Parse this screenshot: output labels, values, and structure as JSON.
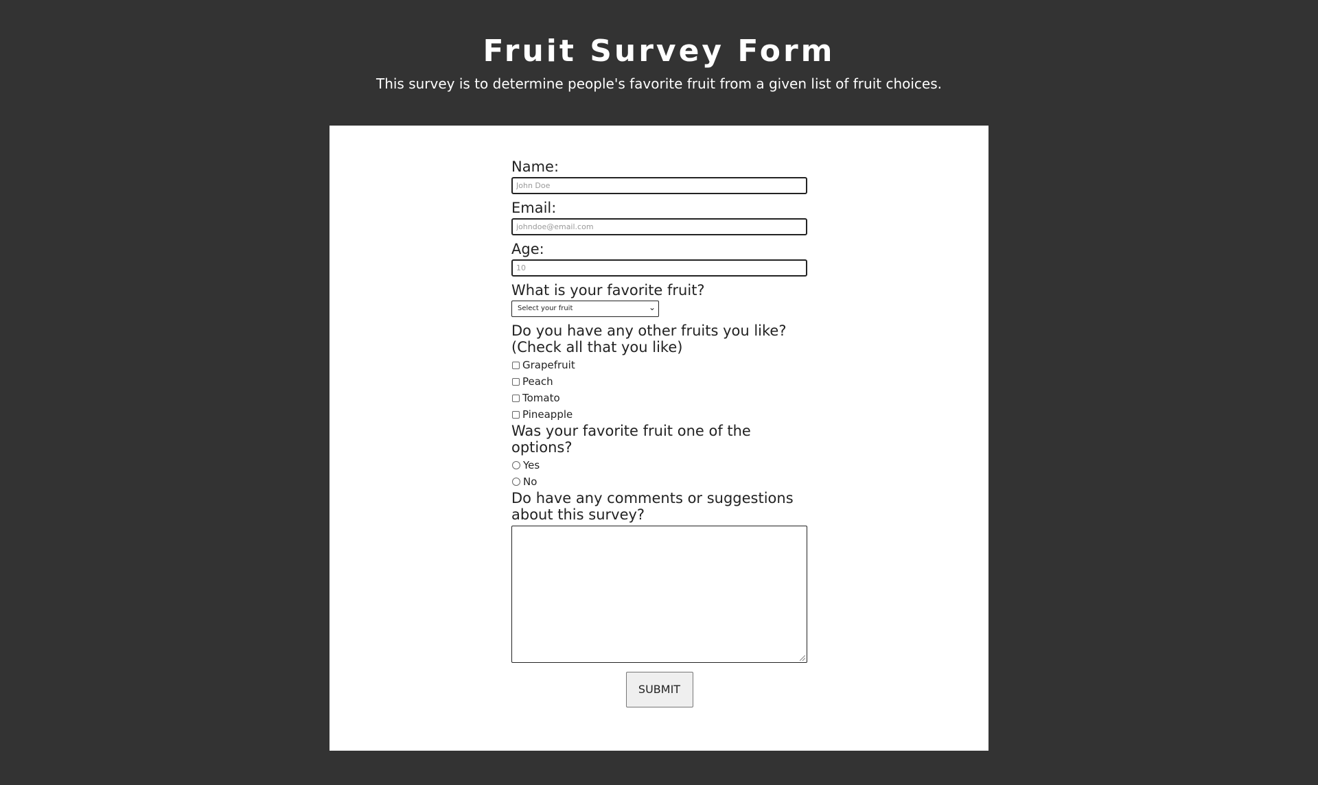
{
  "header": {
    "title": "Fruit Survey Form",
    "description": "This survey is to determine people's favorite fruit from a given list of fruit choices."
  },
  "form": {
    "name": {
      "label": "Name:",
      "placeholder": "John Doe",
      "value": ""
    },
    "email": {
      "label": "Email:",
      "placeholder": "johndoe@email.com",
      "value": ""
    },
    "age": {
      "label": "Age:",
      "placeholder": "10",
      "value": ""
    },
    "favorite_fruit": {
      "label": "What is your favorite fruit?",
      "selected": "Select your fruit"
    },
    "other_fruits": {
      "label": "Do you have any other fruits you like? (Check all that you like)",
      "options": [
        "Grapefruit",
        "Peach",
        "Tomato",
        "Pineapple"
      ]
    },
    "favorite_in_options": {
      "label": "Was your favorite fruit one of the options?",
      "options": [
        "Yes",
        "No"
      ]
    },
    "comments": {
      "label": "Do have any comments or suggestions about this survey?",
      "value": ""
    },
    "submit_label": "SUBMIT"
  },
  "colors": {
    "page_background": "#333333",
    "form_background": "#ffffff",
    "heading_text": "#ffffff"
  },
  "icons": {
    "select_arrow": "chevron-down-icon"
  }
}
